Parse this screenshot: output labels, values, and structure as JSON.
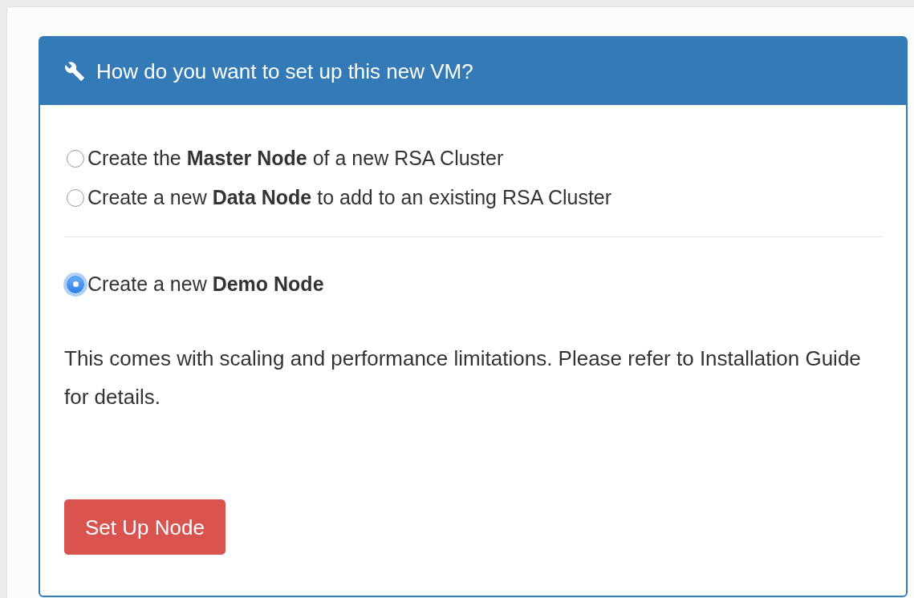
{
  "panel": {
    "title": "How do you want to set up this new VM?",
    "option_groups": [
      [
        {
          "label": "Create the **Master Node** of a new RSA Cluster",
          "selected": false
        },
        {
          "label": "Create a new **Data Node** to add to an existing RSA Cluster",
          "selected": false
        }
      ],
      [
        {
          "label": "Create a new **Demo Node**",
          "selected": true
        }
      ]
    ],
    "note": "This comes with scaling and performance limitations. Please refer to Installation Guide for details.",
    "button": "Set Up Node"
  }
}
